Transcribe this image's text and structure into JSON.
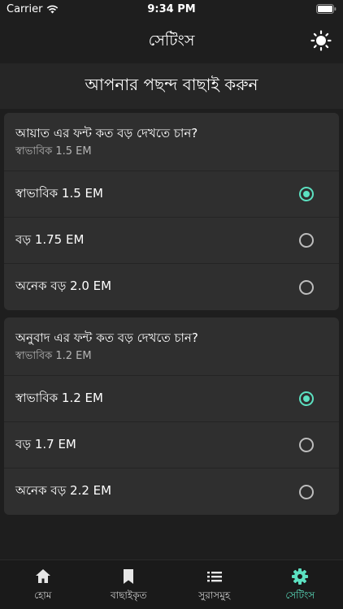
{
  "status": {
    "carrier": "Carrier",
    "time": "9:34 PM"
  },
  "nav": {
    "title": "সেটিংস"
  },
  "header": {
    "title": "আপনার পছন্দ বাছাই করুন"
  },
  "ayat": {
    "question": "আয়াত এর ফন্ট কত বড় দেখতে চান?",
    "current": "স্বাভাবিক 1.5 EM",
    "options": [
      {
        "label": "স্বাভাবিক 1.5 EM",
        "selected": true
      },
      {
        "label": "বড় 1.75 EM",
        "selected": false
      },
      {
        "label": "অনেক বড় 2.0 EM",
        "selected": false
      }
    ]
  },
  "translation": {
    "question": "অনুবাদ এর ফন্ট কত বড় দেখতে চান?",
    "current": "স্বাভাবিক 1.2 EM",
    "options": [
      {
        "label": "স্বাভাবিক 1.2 EM",
        "selected": true
      },
      {
        "label": "বড় 1.7 EM",
        "selected": false
      },
      {
        "label": "অনেক বড় 2.2 EM",
        "selected": false
      }
    ]
  },
  "tabs": [
    {
      "label": "হোম",
      "icon": "home-icon",
      "active": false
    },
    {
      "label": "বাছাইকৃত",
      "icon": "bookmark-icon",
      "active": false
    },
    {
      "label": "সুরাসমুহ",
      "icon": "list-icon",
      "active": false
    },
    {
      "label": "সেটিংস",
      "icon": "gear-icon",
      "active": true
    }
  ],
  "colors": {
    "accent": "#5ce1c1",
    "background": "#1e1e1e",
    "card": "#2f2f2f"
  }
}
